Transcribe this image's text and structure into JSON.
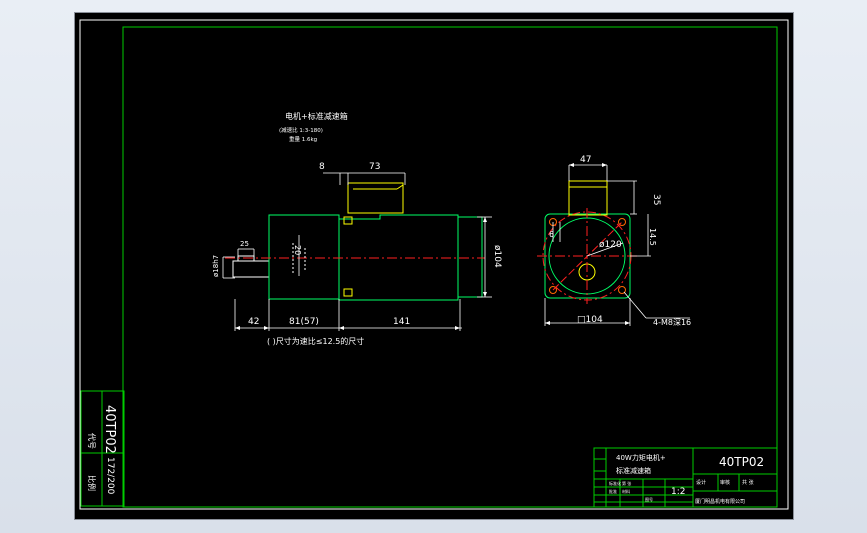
{
  "drawing": {
    "title_main": "电机+标准减速箱",
    "title_sub1": "(减速比 1:3-180)",
    "title_sub2": "重量 1.6kg",
    "note": "( )尺寸为速比≤12.5的尺寸"
  },
  "dimensions": {
    "d8": "8",
    "d73": "73",
    "d42": "42",
    "d81": "81(57)",
    "d141": "141",
    "d104": "ø104",
    "d18": "ø18h7",
    "d25": "25",
    "d20": "20",
    "d47": "47",
    "d35": "35",
    "d145": "14.5",
    "dphi120": "ø120",
    "d6": "6",
    "dsq104": "□104",
    "dm8": "4-M8深16"
  },
  "title_block": {
    "desc_line1": "40W力矩电机+",
    "desc_line2": "标准减速箱",
    "part_no": "40TP02",
    "scale": "1:2",
    "company": "厦门明昌机电有限公司",
    "side_part_no": "40TP02",
    "side_code": "172/200",
    "side_label1": "代号",
    "side_label2": "比例",
    "small1": "设计",
    "small2": "审核",
    "small3": "标准化",
    "small4": "批准",
    "small5": "共 张",
    "small6": "第 张",
    "small7": "材料",
    "small8": "图号"
  },
  "colors": {
    "frame": "#00cc00",
    "outline": "#00ff66",
    "dim": "#ffffff",
    "center": "#ff2020",
    "accent": "#ffff00",
    "hole": "#ff6a00"
  }
}
